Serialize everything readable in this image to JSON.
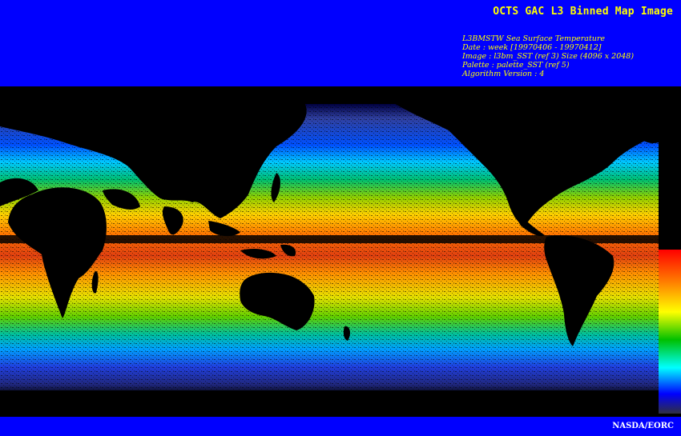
{
  "header": {
    "title": "OCTS GAC L3 Binned Map Image",
    "meta_lines": [
      "L3BMSTW Sea Surface Temperature",
      "Date : week [19970406 - 19970412]",
      "Image : l3bm_SST (ref 3) Size (4096 x 2048)",
      "Palette : palette_SST (ref 5)",
      "Algorithm Version : 4"
    ]
  },
  "footer": {
    "credit": "NASDA/EORC"
  },
  "colors": {
    "frame_blue": "#0000ff",
    "title_yellow": "#ffff00",
    "credit_white": "#ffffff",
    "background": "#000000"
  },
  "palette_colorbar": [
    "#ff0000",
    "#ff8000",
    "#ffff00",
    "#00c000",
    "#00ffff",
    "#0000ff",
    "#303040"
  ],
  "map_image": "global sea surface temperature composite"
}
